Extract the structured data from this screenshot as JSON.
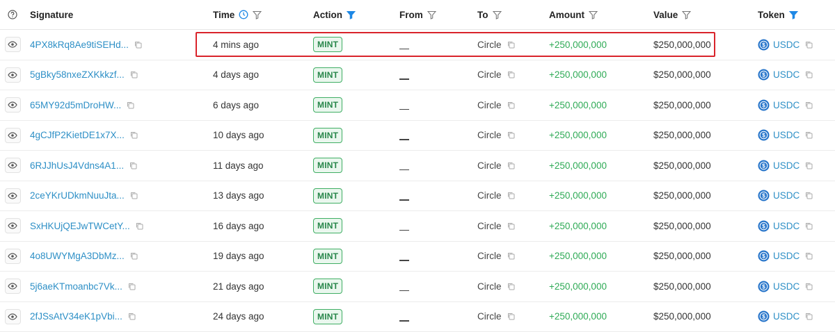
{
  "header": {
    "help_icon": "question-circle-icon",
    "signature": "Signature",
    "time": "Time",
    "action": "Action",
    "from": "From",
    "to": "To",
    "amount": "Amount",
    "value": "Value",
    "token": "Token"
  },
  "colors": {
    "link": "#2d8fc6",
    "positive_amount": "#2eaa55",
    "badge_border": "#3fae63",
    "highlight": "#d9232b",
    "active_filter": "#1e88e5"
  },
  "rows": [
    {
      "signature": "4PX8kRq8Ae9tiSEHd...",
      "time": "4 mins ago",
      "action": "MINT",
      "from": "",
      "to": "Circle",
      "amount": "+250,000,000",
      "value": "$250,000,000",
      "token": "USDC"
    },
    {
      "signature": "5gBky58nxeZXKkkzf...",
      "time": "4 days ago",
      "action": "MINT",
      "from": "",
      "to": "Circle",
      "amount": "+250,000,000",
      "value": "$250,000,000",
      "token": "USDC"
    },
    {
      "signature": "65MY92d5mDroHW...",
      "time": "6 days ago",
      "action": "MINT",
      "from": "",
      "to": "Circle",
      "amount": "+250,000,000",
      "value": "$250,000,000",
      "token": "USDC"
    },
    {
      "signature": "4gCJfP2KietDE1x7X...",
      "time": "10 days ago",
      "action": "MINT",
      "from": "",
      "to": "Circle",
      "amount": "+250,000,000",
      "value": "$250,000,000",
      "token": "USDC"
    },
    {
      "signature": "6RJJhUsJ4Vdns4A1...",
      "time": "11 days ago",
      "action": "MINT",
      "from": "",
      "to": "Circle",
      "amount": "+250,000,000",
      "value": "$250,000,000",
      "token": "USDC"
    },
    {
      "signature": "2ceYKrUDkmNuuJta...",
      "time": "13 days ago",
      "action": "MINT",
      "from": "",
      "to": "Circle",
      "amount": "+250,000,000",
      "value": "$250,000,000",
      "token": "USDC"
    },
    {
      "signature": "SxHKUjQEJwTWCetY...",
      "time": "16 days ago",
      "action": "MINT",
      "from": "",
      "to": "Circle",
      "amount": "+250,000,000",
      "value": "$250,000,000",
      "token": "USDC"
    },
    {
      "signature": "4o8UWYMgA3DbMz...",
      "time": "19 days ago",
      "action": "MINT",
      "from": "",
      "to": "Circle",
      "amount": "+250,000,000",
      "value": "$250,000,000",
      "token": "USDC"
    },
    {
      "signature": "5j6aeKTmoanbc7Vk...",
      "time": "21 days ago",
      "action": "MINT",
      "from": "",
      "to": "Circle",
      "amount": "+250,000,000",
      "value": "$250,000,000",
      "token": "USDC"
    },
    {
      "signature": "2fJSsAtV34eK1pVbi...",
      "time": "24 days ago",
      "action": "MINT",
      "from": "",
      "to": "Circle",
      "amount": "+250,000,000",
      "value": "$250,000,000",
      "token": "USDC"
    }
  ]
}
